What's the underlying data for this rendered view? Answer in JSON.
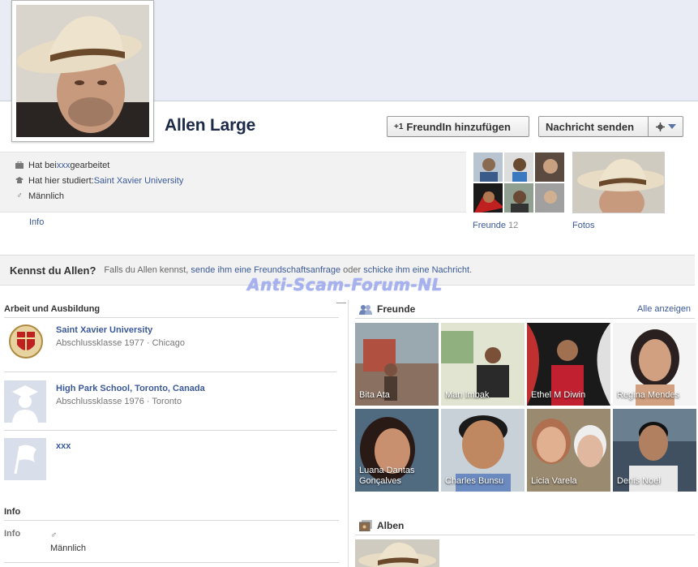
{
  "profile": {
    "name": "Allen Large",
    "add_friend_label": "FreundIn hinzufügen",
    "add_friend_icon": "+1",
    "send_message_label": "Nachricht senden"
  },
  "facts": [
    {
      "icon": "briefcase-icon",
      "prefix": "Hat bei ",
      "link": "xxx",
      "suffix": " gearbeitet"
    },
    {
      "icon": "school-icon",
      "prefix": "Hat hier studiert: ",
      "link": "Saint Xavier University",
      "suffix": ""
    },
    {
      "icon": "male-icon",
      "prefix": "Männlich",
      "link": "",
      "suffix": ""
    }
  ],
  "tabs": {
    "info": "Info",
    "friends_label": "Freunde",
    "friends_count": "12",
    "photos_label": "Fotos"
  },
  "prompt": {
    "heading": "Kennst du Allen?",
    "text_before": "Falls du Allen kennst, ",
    "link1": "sende ihm eine Freundschaftsanfrage",
    "text_mid": " oder ",
    "link2": "schicke ihm eine Nachricht",
    "text_after": "."
  },
  "watermark": "Anti-Scam-Forum-NL",
  "work_education": {
    "heading": "Arbeit und Ausbildung",
    "items": [
      {
        "title": "Saint Xavier University",
        "sub": "Abschlussklasse 1977 · Chicago"
      },
      {
        "title": "High Park School, Toronto, Canada",
        "sub": "Abschlussklasse 1976 · Toronto"
      },
      {
        "title": "xxx",
        "sub": ""
      }
    ]
  },
  "info_section": {
    "heading": "Info",
    "label": "Info",
    "gender_symbol": "♂",
    "gender": "Männlich"
  },
  "friends_box": {
    "heading": "Freunde",
    "see_all": "Alle anzeigen",
    "people": [
      "Bita Ata",
      "Man Imbak",
      "Ethel M Diwin",
      "Regina Mendes",
      "Luana Dantas Gonçalves",
      "Charles Bunsu",
      "Licia Varela",
      "Denis Noel"
    ]
  },
  "albums": {
    "heading": "Alben"
  },
  "colors": {
    "link": "#3b5998",
    "cover": "#e9ecf4",
    "name": "#1c2a47"
  }
}
